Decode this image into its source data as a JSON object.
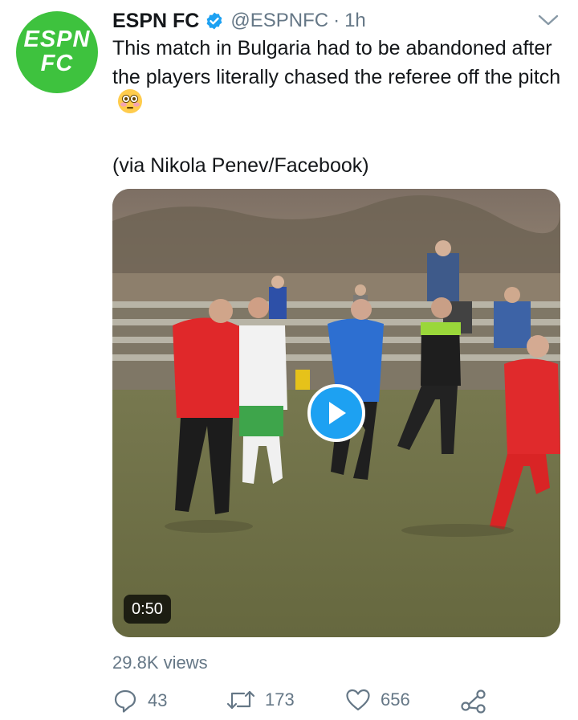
{
  "tweet": {
    "author": {
      "display_name": "ESPN FC",
      "handle": "@ESPNFC",
      "timestamp": "1h",
      "separator": "·",
      "verified": true,
      "avatar_text_line1": "ESPN",
      "avatar_text_line2": "FC"
    },
    "text": "This match in Bulgaria had to be abandoned after the players literally chased the referee off the pitch",
    "emoji": "flushed-face",
    "via": "(via Nikola Penev/Facebook)",
    "video": {
      "duration": "0:50",
      "play_icon": "play-icon"
    },
    "views": "29.8K views",
    "actions": {
      "reply_count": "43",
      "retweet_count": "173",
      "like_count": "656"
    }
  },
  "colors": {
    "avatar_green": "#3ec23e",
    "verified_blue": "#1da1f2",
    "play_blue": "#1da1f2",
    "muted_text": "#657786",
    "text": "#14171a"
  }
}
